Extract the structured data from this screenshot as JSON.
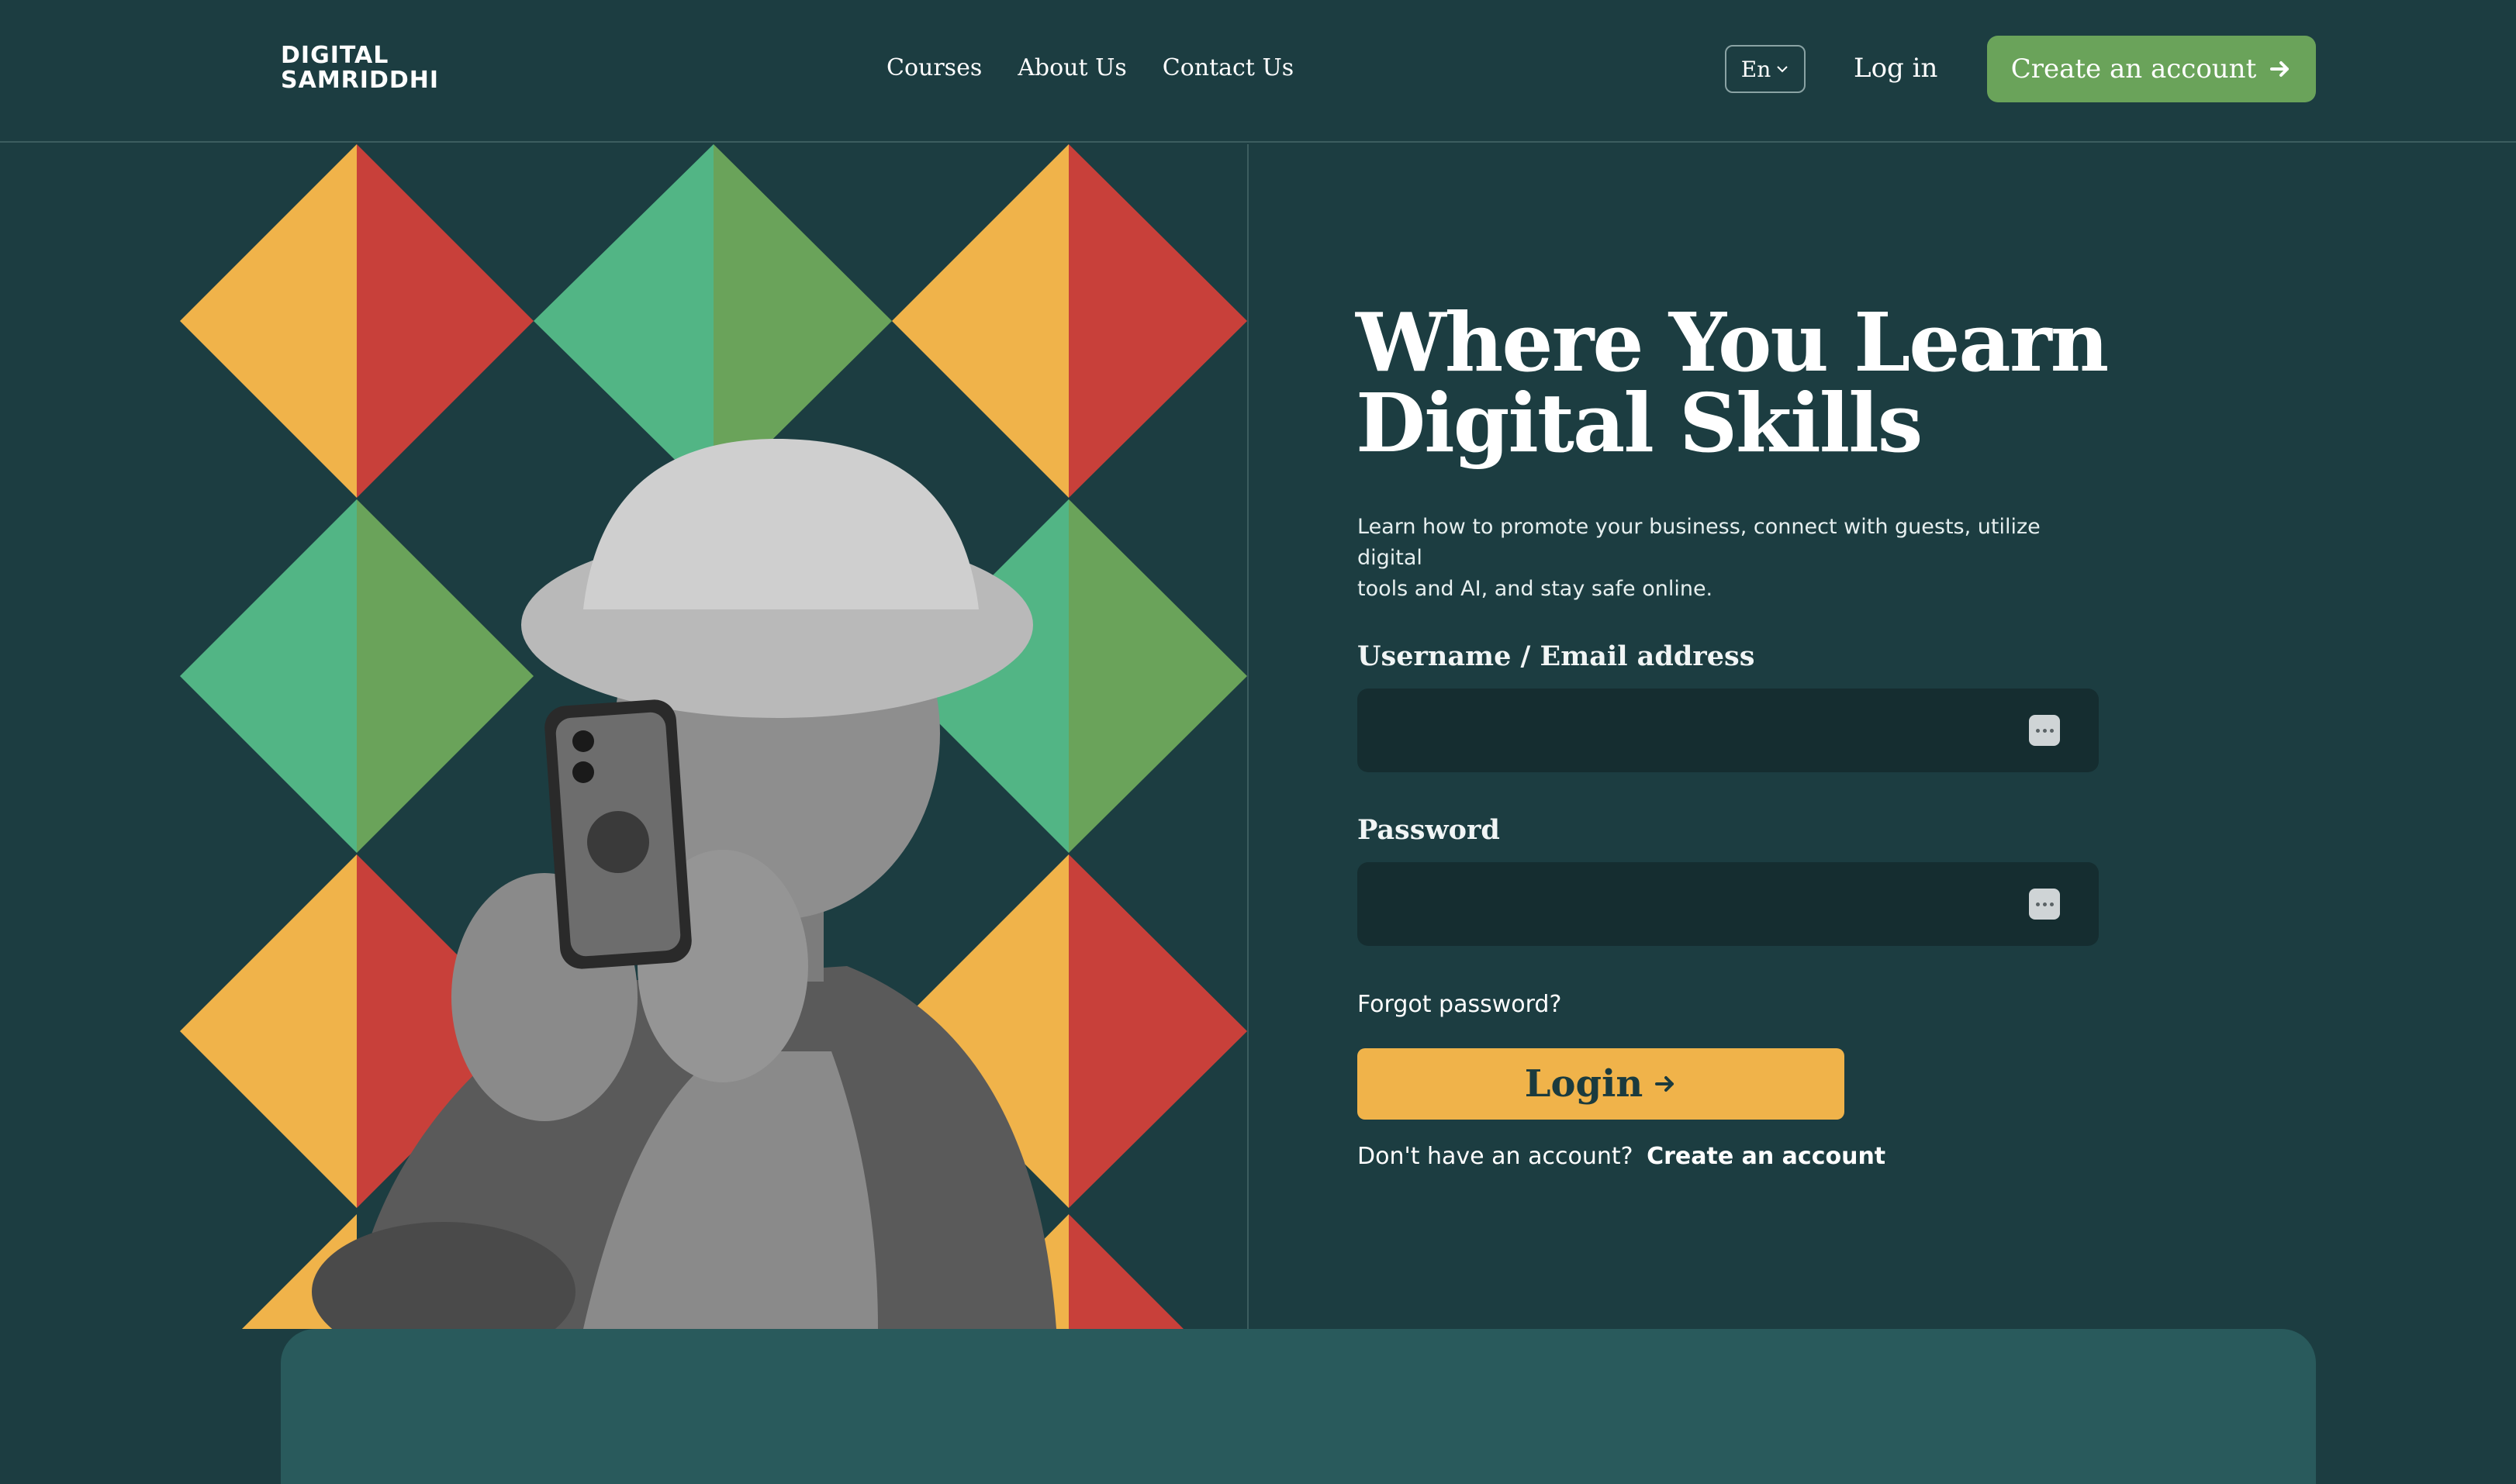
{
  "brand": {
    "line1": "DIGITAL",
    "line2": "SAMRIDDHI"
  },
  "nav": {
    "items": [
      {
        "label": "Courses"
      },
      {
        "label": "About Us"
      },
      {
        "label": "Contact Us"
      }
    ]
  },
  "header": {
    "language": "En",
    "login_label": "Log in",
    "cta_label": "Create an account"
  },
  "hero": {
    "title_line1": "Where You Learn",
    "title_line2": "Digital Skills",
    "subtitle_line1": "Learn how to promote your business, connect with guests, utilize digital",
    "subtitle_line2": "tools and AI, and stay safe online."
  },
  "form": {
    "username_label": "Username / Email address",
    "username_value": "",
    "password_label": "Password",
    "password_value": "",
    "forgot_label": "Forgot password?",
    "submit_label": "Login",
    "signup_prompt": "Don't have an account?",
    "signup_link": "Create an account"
  },
  "colors": {
    "background": "#1c3d41",
    "accent_green": "#6aa35a",
    "accent_yellow": "#f0b34a",
    "accent_red": "#c8403a",
    "accent_teal": "#52b585",
    "panel": "#295a5c"
  },
  "icons": [
    "chevron-down-icon",
    "arrow-right-icon",
    "password-manager-icon"
  ]
}
